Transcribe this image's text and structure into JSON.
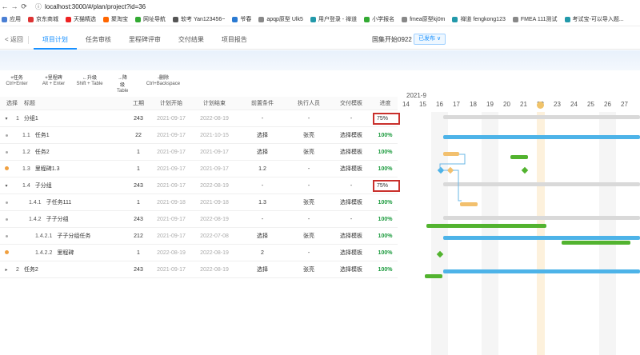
{
  "browser": {
    "url": "localhost:3000/#/plan/project?id=36",
    "bookmarks": [
      {
        "label": "应用",
        "color": "#4a7fd4"
      },
      {
        "label": "京东商城",
        "color": "#d33"
      },
      {
        "label": "天猫精选",
        "color": "#e22"
      },
      {
        "label": "聚淘宝",
        "color": "#f60"
      },
      {
        "label": "网址导航",
        "color": "#3a3"
      },
      {
        "label": "软考 Yan123456~",
        "color": "#555"
      },
      {
        "label": "爷春",
        "color": "#2a7ad2"
      },
      {
        "label": "apqp原型 Ulk5",
        "color": "#888"
      },
      {
        "label": "用户登录 - 禅道",
        "color": "#29a"
      },
      {
        "label": "小学报名",
        "color": "#3a3"
      },
      {
        "label": "fmea原型kj0m",
        "color": "#888"
      },
      {
        "label": "禅道 fengkong123",
        "color": "#29a"
      },
      {
        "label": "FMEA 111测试",
        "color": "#888"
      },
      {
        "label": "考试宝-可以导入题...",
        "color": "#29a"
      }
    ]
  },
  "topnav": {
    "back_label": "返回",
    "tabs": [
      "项目计划",
      "任务审核",
      "里程碑评审",
      "交付结果",
      "项目报告"
    ],
    "project_name": "国集开始0922",
    "status_label": "已发布 ∨"
  },
  "toolbar": [
    {
      "label": "+任务",
      "keys": "Ctrl+Enter"
    },
    {
      "label": "+里程碑",
      "keys": "Alt + Enter"
    },
    {
      "label": "←升级",
      "keys": "Shift + Table"
    },
    {
      "label": "→降级",
      "keys": "Table"
    },
    {
      "label": "-删除",
      "keys": "Ctrl+Backspace"
    }
  ],
  "grid": {
    "headers": {
      "sel": "选择",
      "title": "标题",
      "work": "工期",
      "plan_start": "计划开始",
      "plan_end": "计划结束",
      "pre": "前置条件",
      "exe": "执行人员",
      "tpl": "交付模板",
      "prog": "进度"
    },
    "rows": [
      {
        "caret": "▾",
        "num": "1",
        "title": "分组1",
        "work": "243",
        "ps": "2021-09-17",
        "pe": "2022-08-19",
        "pre": "-",
        "exe": "-",
        "tpl": "-",
        "prog": "75%",
        "kind": "group",
        "indent": 0
      },
      {
        "caret": "",
        "num": "1.1",
        "title": "任务1",
        "work": "22",
        "ps": "2021-09-17",
        "pe": "2021-10-15",
        "pre": "选择",
        "exe": "张亮",
        "tpl": "选择模板",
        "prog": "100%",
        "kind": "task",
        "indent": 1
      },
      {
        "caret": "",
        "num": "1.2",
        "title": "任务2",
        "work": "1",
        "ps": "2021-09-17",
        "pe": "2021-09-17",
        "pre": "选择",
        "exe": "张亮",
        "tpl": "选择模板",
        "prog": "100%",
        "kind": "task",
        "indent": 1
      },
      {
        "caret": "",
        "num": "1.3",
        "title": "里程碑1.3",
        "work": "1",
        "ps": "2021-09-17",
        "pe": "2021-09-17",
        "pre": "1.2",
        "exe": "-",
        "tpl": "选择模板",
        "prog": "100%",
        "kind": "milestone",
        "indent": 1
      },
      {
        "caret": "▾",
        "num": "1.4",
        "title": "子分组",
        "work": "243",
        "ps": "2021-09-17",
        "pe": "2022-08-19",
        "pre": "-",
        "exe": "-",
        "tpl": "-",
        "prog": "75%",
        "kind": "group",
        "indent": 1
      },
      {
        "caret": "",
        "num": "1.4.1",
        "title": "子任务111",
        "work": "1",
        "ps": "2021-09-18",
        "pe": "2021-09-18",
        "pre": "1.3",
        "exe": "张亮",
        "tpl": "选择模板",
        "prog": "100%",
        "kind": "task",
        "indent": 2
      },
      {
        "caret": "",
        "num": "1.4.2",
        "title": "子子分组",
        "work": "243",
        "ps": "2021-09-17",
        "pe": "2022-08-19",
        "pre": "-",
        "exe": "-",
        "tpl": "-",
        "prog": "100%",
        "kind": "task",
        "indent": 2
      },
      {
        "caret": "",
        "num": "1.4.2.1",
        "title": "子子分组任务",
        "work": "212",
        "ps": "2021-09-17",
        "pe": "2022-07-08",
        "pre": "选择",
        "exe": "张亮",
        "tpl": "选择模板",
        "prog": "100%",
        "kind": "task",
        "indent": 3
      },
      {
        "caret": "",
        "num": "1.4.2.2",
        "title": "里程碑",
        "work": "1",
        "ps": "2022-08-19",
        "pe": "2022-08-19",
        "pre": "2",
        "exe": "-",
        "tpl": "选择模板",
        "prog": "100%",
        "kind": "milestone",
        "indent": 3
      },
      {
        "caret": "▸",
        "num": "2",
        "title": "任务2",
        "work": "243",
        "ps": "2021-09-17",
        "pe": "2022-08-19",
        "pre": "选择",
        "exe": "张亮",
        "tpl": "选择模板",
        "prog": "100%",
        "kind": "task",
        "indent": 0
      }
    ]
  },
  "gantt": {
    "month": "2021-9",
    "days": [
      "14",
      "15",
      "16",
      "17",
      "18",
      "19",
      "20",
      "21",
      "22",
      "23",
      "24",
      "25",
      "26",
      "27"
    ],
    "today_label": "22",
    "colors": {
      "gray": "#d9d9d9",
      "blue": "#4db3e8",
      "orange": "#f2c06e",
      "green": "#52b32f",
      "link": "#6ab7e6"
    }
  }
}
